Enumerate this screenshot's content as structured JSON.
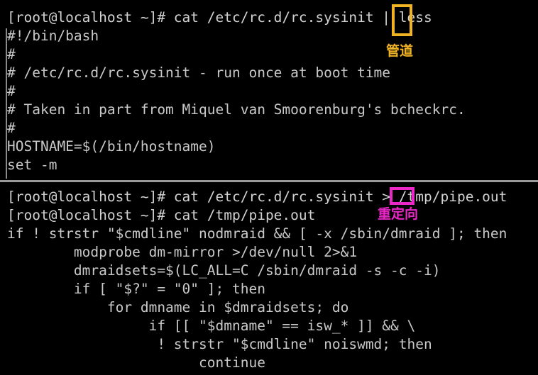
{
  "terminal": {
    "prompt": "[root@localhost ~]#",
    "text_color": "#c9c9c9",
    "background_color": "#000000",
    "top_pane": {
      "name": "pager-output-pane",
      "lines": [
        "[root@localhost ~]# cat /etc/rc.d/rc.sysinit | less",
        "#!/bin/bash",
        "#",
        "# /etc/rc.d/rc.sysinit - run once at boot time",
        "#",
        "# Taken in part from Miquel van Smoorenburg's bcheckrc.",
        "#",
        "HOSTNAME=$(/bin/hostname)",
        "set -m"
      ]
    },
    "bottom_pane": {
      "name": "shell-output-pane",
      "lines": [
        "[root@localhost ~]# cat /etc/rc.d/rc.sysinit > /tmp/pipe.out",
        "[root@localhost ~]# cat /tmp/pipe.out",
        "if ! strstr \"$cmdline\" nodmraid && [ -x /sbin/dmraid ]; then",
        "        modprobe dm-mirror >/dev/null 2>&1",
        "        dmraidsets=$(LC_ALL=C /sbin/dmraid -s -c -i)",
        "        if [ \"$?\" = \"0\" ]; then",
        "            for dmname in $dmraidsets; do",
        "                 if [[ \"$dmname\" == isw_* ]] && \\",
        "                  ! strstr \"$cmdline\" noiswmd; then",
        "                       continue"
      ]
    }
  },
  "annotations": {
    "pipe": {
      "label": "管道",
      "color": "#f0b323",
      "target_character": "|",
      "meaning": "pipe"
    },
    "redirect": {
      "label": "重定向",
      "color": "#ea28c8",
      "target_character": ">",
      "meaning": "redirect"
    }
  }
}
